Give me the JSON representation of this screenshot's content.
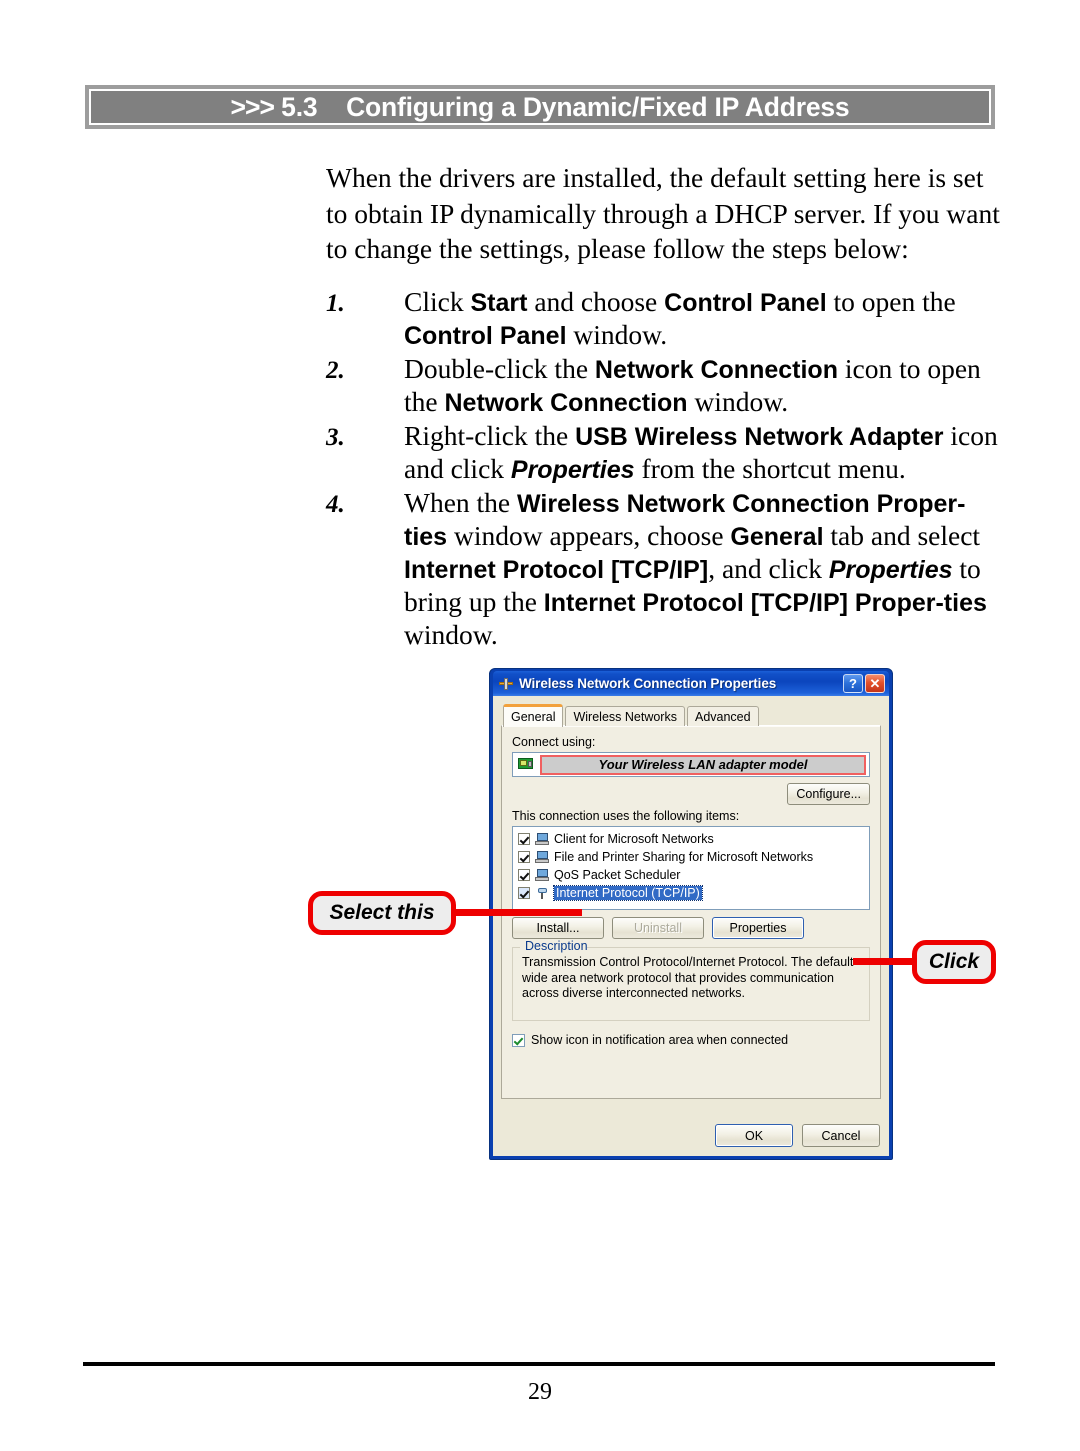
{
  "header": {
    "chevrons": ">>>",
    "section_number": "5.3",
    "title": "Configuring a Dynamic/Fixed IP Address",
    "bar_color": "#808080"
  },
  "intro": {
    "paragraph": "When the drivers are installed, the default setting here is set to obtain IP dynamically through a DHCP server.  If you want to change the settings, please follow the steps below:"
  },
  "steps": [
    {
      "number": "1.",
      "parts": [
        {
          "t": "Click ",
          "s": "normal"
        },
        {
          "t": "Start",
          "s": "bold"
        },
        {
          "t": " and choose ",
          "s": "normal"
        },
        {
          "t": "Control Panel",
          "s": "bold"
        },
        {
          "t": " to open the ",
          "s": "normal"
        },
        {
          "t": "Control Panel",
          "s": "bold"
        },
        {
          "t": " window.",
          "s": "normal"
        }
      ]
    },
    {
      "number": "2.",
      "parts": [
        {
          "t": "Double-click the ",
          "s": "normal"
        },
        {
          "t": "Network Connection",
          "s": "bold"
        },
        {
          "t": " icon to open the ",
          "s": "normal"
        },
        {
          "t": "Network Connection",
          "s": "bold"
        },
        {
          "t": " window.",
          "s": "normal"
        }
      ]
    },
    {
      "number": "3.",
      "parts": [
        {
          "t": "Right-click the ",
          "s": "normal"
        },
        {
          "t": "USB Wireless Network Adapter",
          "s": "bold"
        },
        {
          "t": " icon and click ",
          "s": "normal"
        },
        {
          "t": "Properties",
          "s": "bolditalic"
        },
        {
          "t": " from the shortcut menu.",
          "s": "normal"
        }
      ]
    },
    {
      "number": "4.",
      "parts": [
        {
          "t": "When the ",
          "s": "normal"
        },
        {
          "t": "Wireless Network Connection Proper-ties",
          "s": "bold"
        },
        {
          "t": " window appears, choose ",
          "s": "normal"
        },
        {
          "t": "General",
          "s": "bold"
        },
        {
          "t": " tab and select ",
          "s": "normal"
        },
        {
          "t": "Internet Protocol [TCP/IP]",
          "s": "bold"
        },
        {
          "t": ", and click ",
          "s": "normal"
        },
        {
          "t": "Properties",
          "s": "bolditalic"
        },
        {
          "t": " to bring up the ",
          "s": "normal"
        },
        {
          "t": "Internet Protocol [TCP/IP] Proper-ties",
          "s": "bold"
        },
        {
          "t": " window.",
          "s": "normal"
        }
      ]
    }
  ],
  "dialog": {
    "title": "Wireless Network Connection Properties",
    "title_icon": "network-connection-icon",
    "help_button": "?",
    "close_button": "✕",
    "tabs": [
      {
        "label": "General",
        "active": true
      },
      {
        "label": "Wireless Networks",
        "active": false
      },
      {
        "label": "Advanced",
        "active": false
      }
    ],
    "connect_using_label": "Connect using:",
    "adapter_name": "Your Wireless LAN adapter model",
    "configure_button": "Configure...",
    "items_label": "This connection uses the following items:",
    "items": [
      {
        "label": "Client for Microsoft Networks",
        "checked": true,
        "selected": false
      },
      {
        "label": "File and Printer Sharing for Microsoft Networks",
        "checked": true,
        "selected": false
      },
      {
        "label": "QoS Packet Scheduler",
        "checked": true,
        "selected": false
      },
      {
        "label": "Internet Protocol (TCP/IP)",
        "checked": true,
        "selected": true
      }
    ],
    "install_button": "Install...",
    "uninstall_button": "Uninstall",
    "properties_button": "Properties",
    "description_legend": "Description",
    "description_text": "Transmission Control Protocol/Internet Protocol. The default wide area network protocol that provides communication across diverse interconnected networks.",
    "show_icon_label": "Show icon in notification area when connected",
    "show_icon_checked": true,
    "ok_button": "OK",
    "cancel_button": "Cancel"
  },
  "callouts": {
    "select_this": "Select this",
    "click": "Click",
    "color": "#ee0000"
  },
  "footer": {
    "page_number": "29"
  }
}
